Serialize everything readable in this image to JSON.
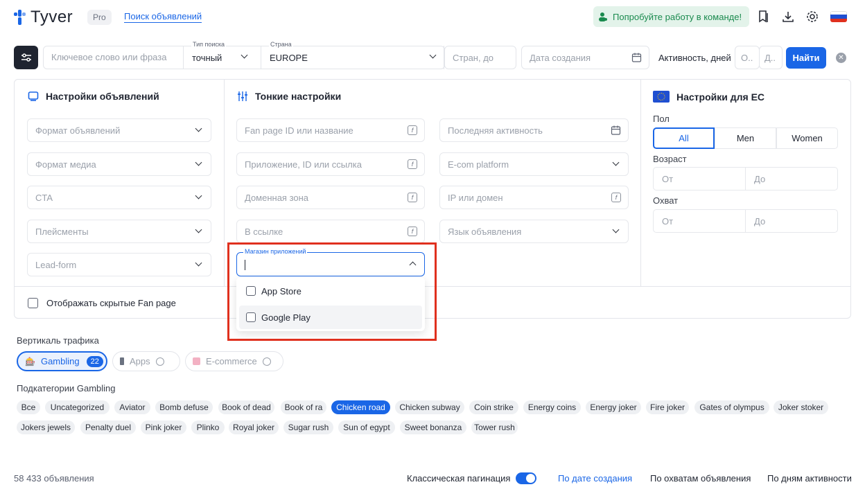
{
  "header": {
    "brand": "Tyver",
    "badge": "Pro",
    "search_link": "Поиск объявлений",
    "team_button": "Попробуйте работу в команде!"
  },
  "search": {
    "keyword_placeholder": "Ключевое слово или фраза",
    "search_type_label": "Тип поиска",
    "search_type_value": "точный",
    "country_label": "Страна",
    "country_value": "EUROPE",
    "countries_placeholder": "Стран, до",
    "date_placeholder": "Дата создания",
    "activity_label": "Активность, дней",
    "activity_from": "О..",
    "activity_to": "Д..",
    "find_button": "Найти"
  },
  "ad_settings": {
    "title": "Настройки объявлений",
    "fields": [
      "Формат объявлений",
      "Формат медиа",
      "CTA",
      "Плейсменты",
      "Lead-form"
    ]
  },
  "fine_settings": {
    "title": "Тонкие настройки",
    "left_fields": [
      "Fan page ID или название",
      "Приложение, ID или ссылка",
      "Доменная зона",
      "В ссылке"
    ],
    "right_fields": [
      "Последняя активность",
      "E-com platform",
      "IP или домен",
      "Язык объявления"
    ],
    "store_label": "Магазин приложений",
    "store_options": [
      "App Store",
      "Google Play"
    ]
  },
  "eu_settings": {
    "title": "Настройки для ЕС",
    "gender_label": "Пол",
    "gender_options": [
      "All",
      "Men",
      "Women"
    ],
    "age_label": "Возраст",
    "reach_label": "Охват",
    "from": "От",
    "to": "До"
  },
  "hidden_fanpage": "Отображать скрытые Fan page",
  "verticals": {
    "label": "Вертикаль трафика",
    "items": [
      {
        "label": "Gambling",
        "count": "22"
      },
      {
        "label": "Apps"
      },
      {
        "label": "E-commerce"
      }
    ]
  },
  "subcategories": {
    "label": "Подкатегории Gambling",
    "row1": [
      "Все",
      "Uncategorized",
      "Aviator",
      "Bomb defuse",
      "Book of dead",
      "Book of ra",
      "Chicken road",
      "Chicken subway",
      "Coin strike",
      "Energy coins",
      "Energy joker",
      "Fire joker",
      "Gates of olympus",
      "Joker stoker"
    ],
    "row2": [
      "Jokers jewels",
      "Penalty duel",
      "Pink joker",
      "Plinko",
      "Royal joker",
      "Sugar rush",
      "Sun of egypt",
      "Sweet bonanza",
      "Tower rush"
    ],
    "active": "Chicken road"
  },
  "footer": {
    "count": "58 433 объявления",
    "pagination_label": "Классическая пагинация",
    "sort_date": "По дате создания",
    "sort_reach": "По охватам объявления",
    "sort_activity": "По дням активности"
  },
  "colors": {
    "accent": "#1a66e6",
    "highlight": "#e0301e",
    "team_bg": "#e3f3ea"
  }
}
